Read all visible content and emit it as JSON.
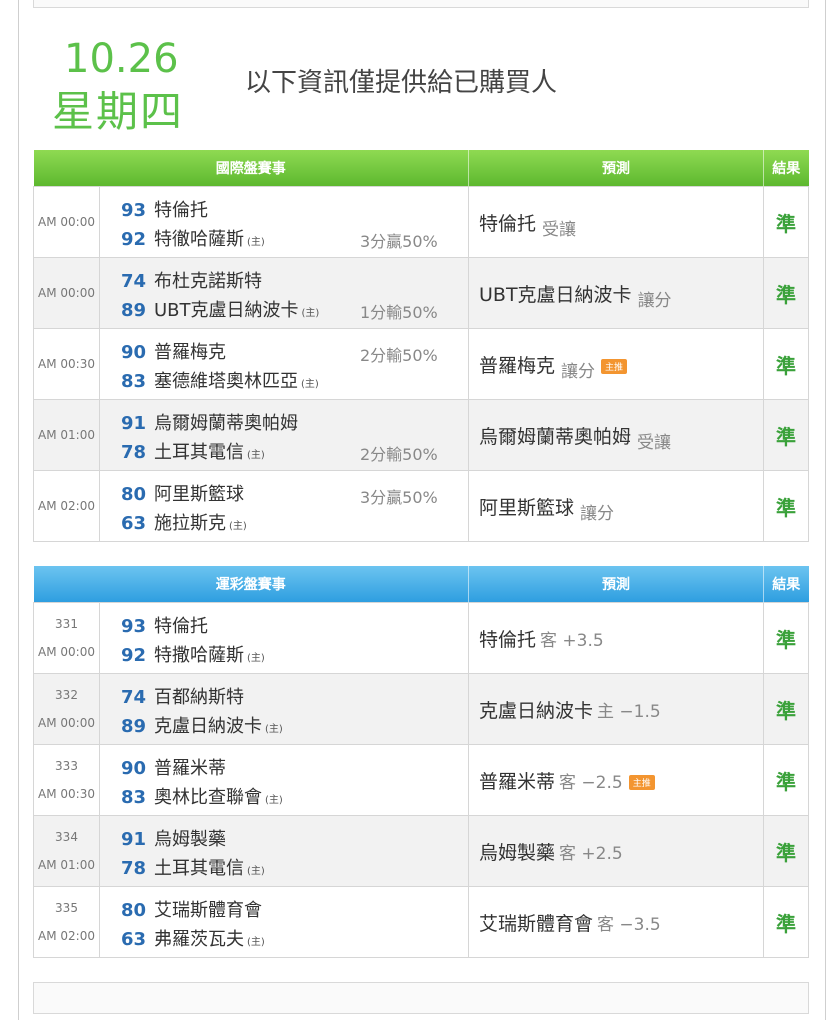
{
  "header": {
    "date": "10.26",
    "weekday": "星期四",
    "notice": "以下資訊僅提供給已購買人"
  },
  "intl": {
    "headers": {
      "match": "國際盤賽事",
      "prediction": "預測",
      "result": "結果"
    },
    "rows": [
      {
        "time": "AM 00:00",
        "s1": "93",
        "t1": "特倫托",
        "h1": "",
        "s2": "92",
        "t2": "特徹哈薩斯",
        "h2": "(主)",
        "odds": "3分贏50%",
        "odds_line": 2,
        "pred_team": "特倫托",
        "pred_note": "受讓",
        "badge": "",
        "result": "準"
      },
      {
        "time": "AM 00:00",
        "s1": "74",
        "t1": "布杜克諾斯特",
        "h1": "",
        "s2": "89",
        "t2": "UBT克盧日納波卡",
        "h2": "(主)",
        "odds": "1分輸50%",
        "odds_line": 2,
        "pred_team": "UBT克盧日納波卡",
        "pred_note": "讓分",
        "badge": "",
        "result": "準"
      },
      {
        "time": "AM 00:30",
        "s1": "90",
        "t1": "普羅梅克",
        "h1": "",
        "s2": "83",
        "t2": "塞德維塔奧林匹亞",
        "h2": "(主)",
        "odds": "2分輸50%",
        "odds_line": 1,
        "pred_team": "普羅梅克",
        "pred_note": "讓分",
        "badge": "主推",
        "result": "準"
      },
      {
        "time": "AM 01:00",
        "s1": "91",
        "t1": "烏爾姆蘭蒂奧帕姆",
        "h1": "",
        "s2": "78",
        "t2": "土耳其電信",
        "h2": "(主)",
        "odds": "2分輸50%",
        "odds_line": 2,
        "pred_team": "烏爾姆蘭蒂奧帕姆",
        "pred_note": "受讓",
        "badge": "",
        "result": "準"
      },
      {
        "time": "AM 02:00",
        "s1": "80",
        "t1": "阿里斯籃球",
        "h1": "",
        "s2": "63",
        "t2": "施拉斯克",
        "h2": "(主)",
        "odds": "3分贏50%",
        "odds_line": 1,
        "pred_team": "阿里斯籃球",
        "pred_note": "讓分",
        "badge": "",
        "result": "準"
      }
    ]
  },
  "lottery": {
    "headers": {
      "match": "運彩盤賽事",
      "prediction": "預測",
      "result": "結果"
    },
    "rows": [
      {
        "no": "331",
        "time": "AM 00:00",
        "s1": "93",
        "t1": "特倫托",
        "s2": "92",
        "t2": "特撒哈薩斯",
        "h2": "(主)",
        "pred_team": "特倫托",
        "pred_note": "客 +3.5",
        "badge": "",
        "result": "準"
      },
      {
        "no": "332",
        "time": "AM 00:00",
        "s1": "74",
        "t1": "百都納斯特",
        "s2": "89",
        "t2": "克盧日納波卡",
        "h2": "(主)",
        "pred_team": "克盧日納波卡",
        "pred_note": "主 −1.5",
        "badge": "",
        "result": "準"
      },
      {
        "no": "333",
        "time": "AM 00:30",
        "s1": "90",
        "t1": "普羅米蒂",
        "s2": "83",
        "t2": "奧林比查聯會",
        "h2": "(主)",
        "pred_team": "普羅米蒂",
        "pred_note": "客 −2.5",
        "badge": "主推",
        "result": "準"
      },
      {
        "no": "334",
        "time": "AM 01:00",
        "s1": "91",
        "t1": "烏姆製藥",
        "s2": "78",
        "t2": "土耳其電信",
        "h2": "(主)",
        "pred_team": "烏姆製藥",
        "pred_note": "客 +2.5",
        "badge": "",
        "result": "準"
      },
      {
        "no": "335",
        "time": "AM 02:00",
        "s1": "80",
        "t1": "艾瑞斯體育會",
        "s2": "63",
        "t2": "弗羅茨瓦夫",
        "h2": "(主)",
        "pred_team": "艾瑞斯體育會",
        "pred_note": "客 −3.5",
        "badge": "",
        "result": "準"
      }
    ]
  },
  "colors": {
    "accent_green": "#5cc14a",
    "header_green": "#6ec63c",
    "header_blue": "#3aa6e6",
    "score_blue": "#2a6bb0",
    "result_green": "#3aa13a",
    "badge_orange": "#f39530"
  }
}
